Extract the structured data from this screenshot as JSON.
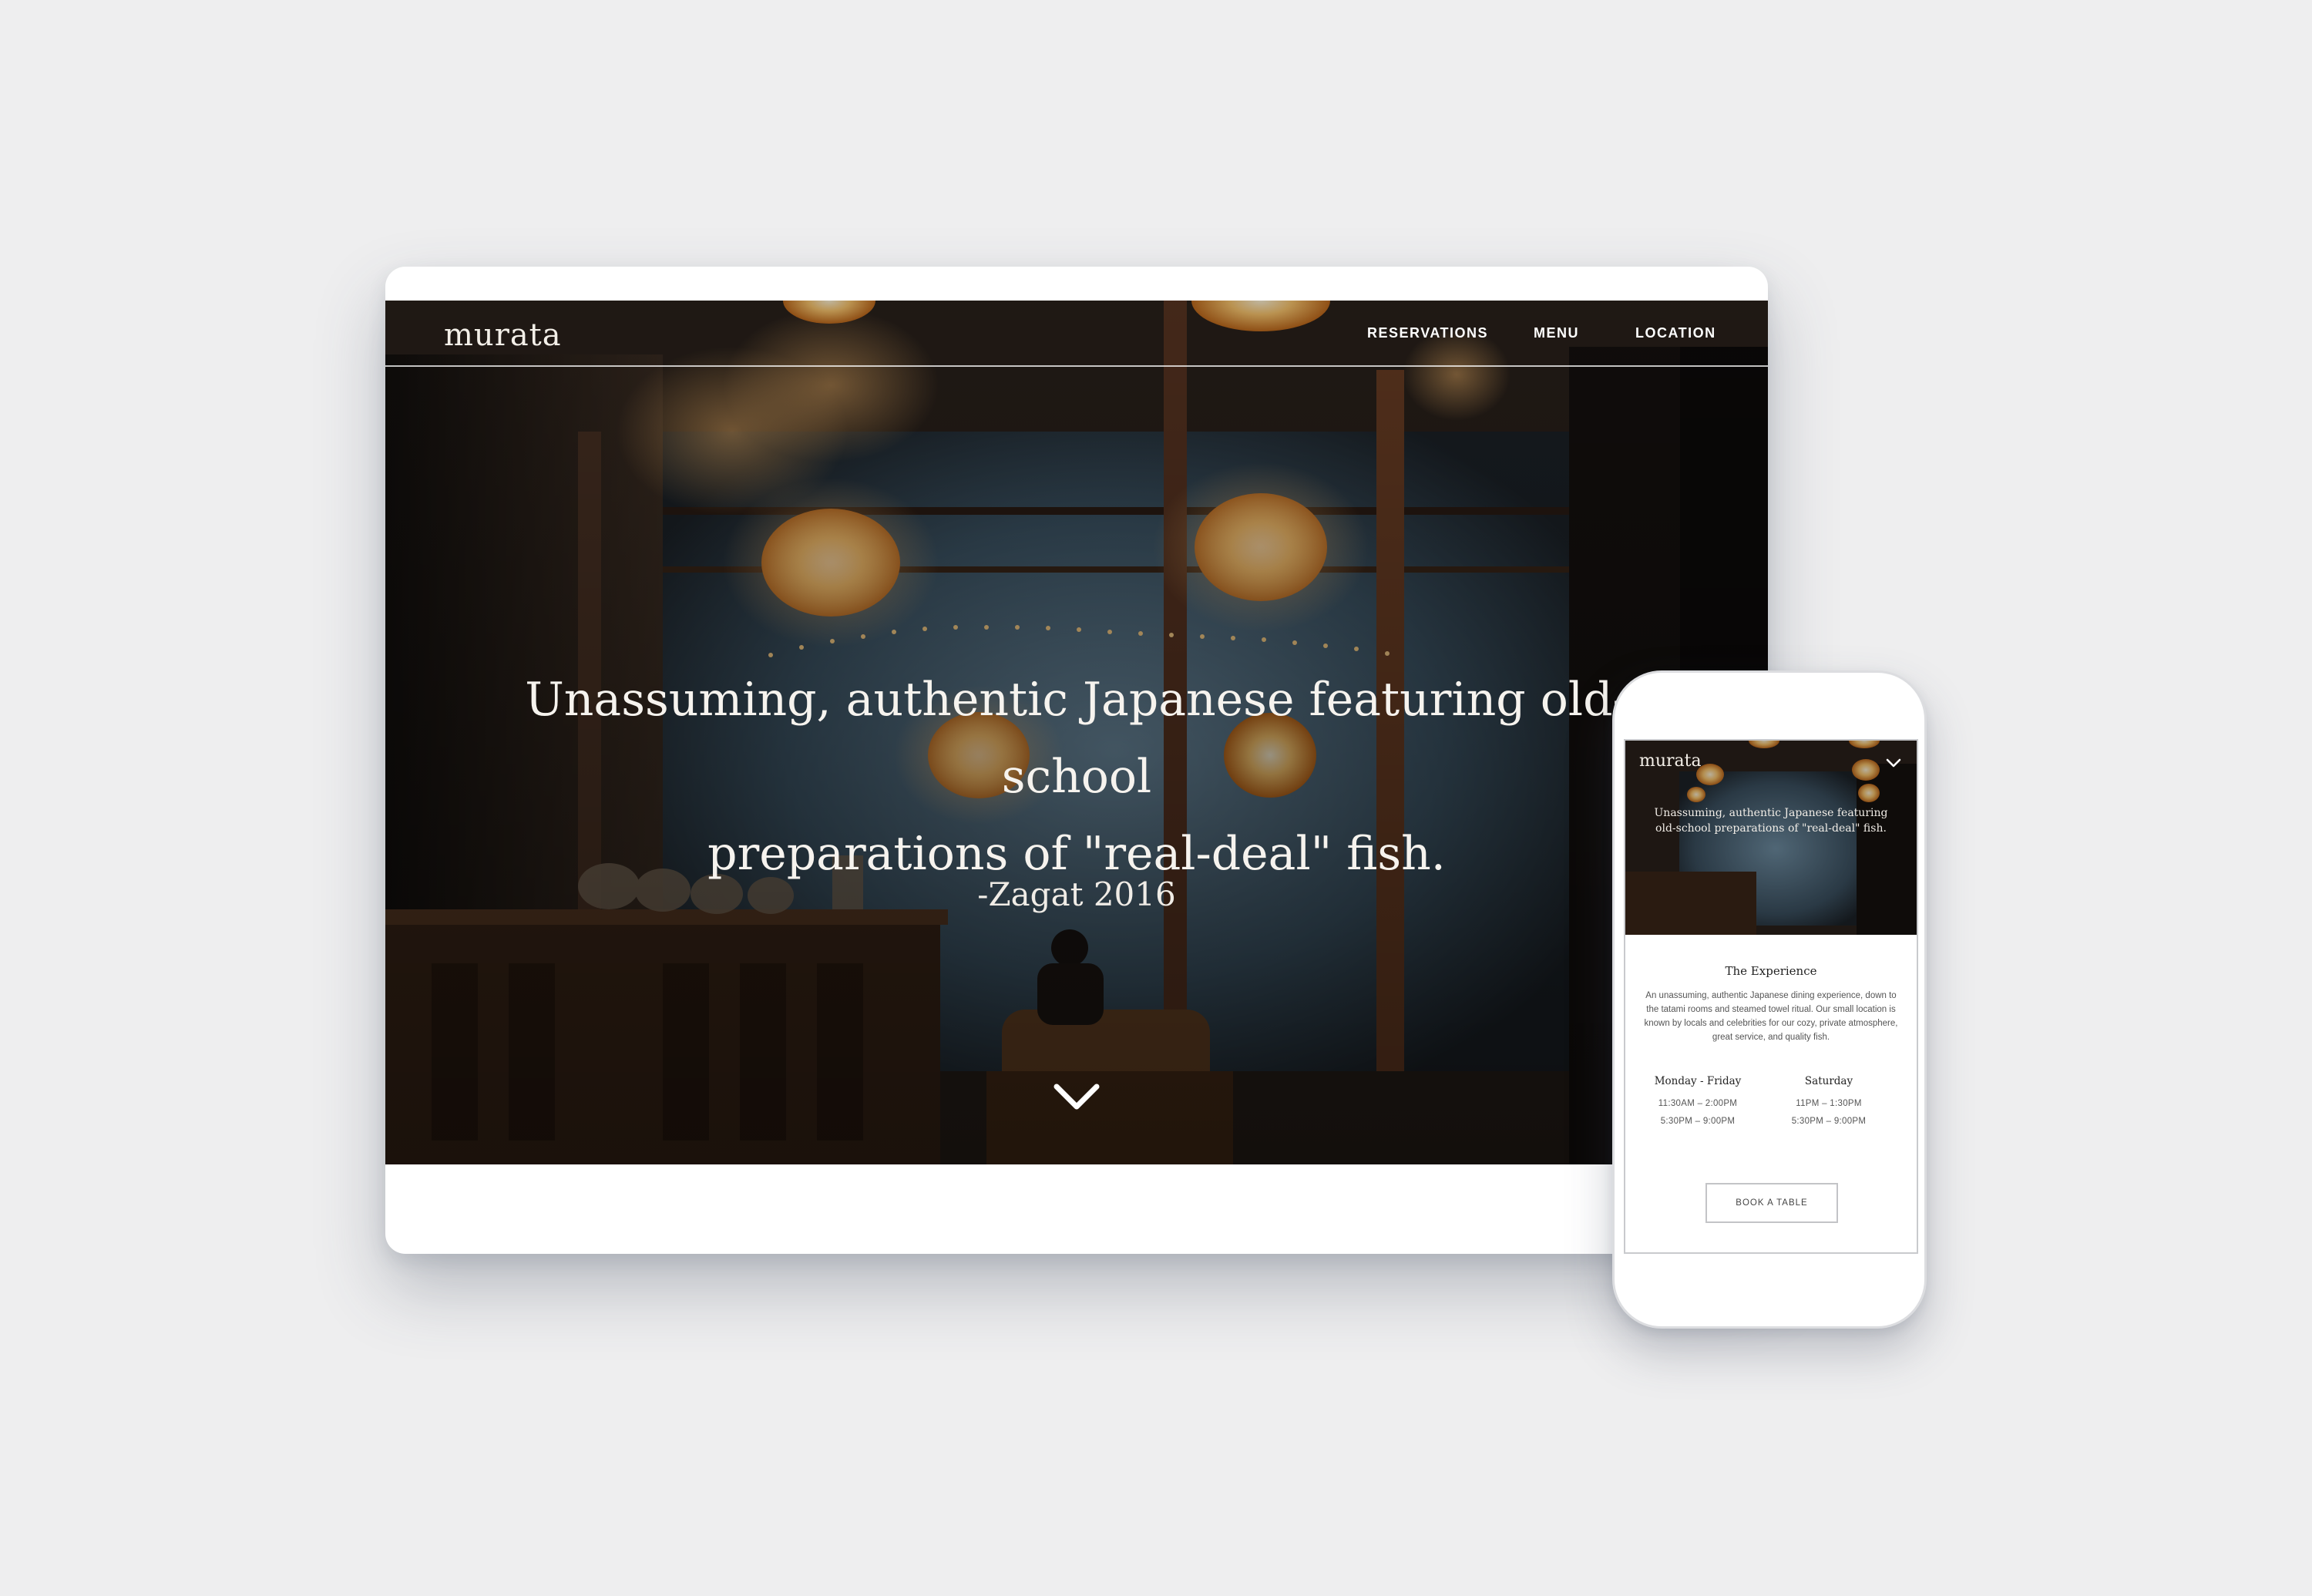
{
  "desktop": {
    "logo": "murata",
    "nav": {
      "reservations": "RESERVATIONS",
      "menu": "MENU",
      "location": "LOCATION"
    },
    "hero": {
      "line1": "Unassuming, authentic Japanese featuring old-school",
      "line2": "preparations of \"real-deal\" fish.",
      "cite": "-Zagat 2016",
      "scroll_icon": "chevron-down-icon"
    }
  },
  "mobile": {
    "logo": "murata",
    "menu_icon": "chevron-down-icon",
    "hero": {
      "line1": "Unassuming, authentic Japanese featuring",
      "line2": "old-school preparations of \"real-deal\" fish."
    },
    "experience": {
      "title": "The Experience",
      "description": "An unassuming, authentic Japanese dining experience, down to the tatami rooms and steamed towel ritual. Our small location is known by locals and celebrities for our cozy, private atmosphere, great service, and quality fish."
    },
    "hours": [
      {
        "days": "Monday - Friday",
        "lunch": "11:30AM – 2:00PM",
        "dinner": "5:30PM – 9:00PM"
      },
      {
        "days": "Saturday",
        "lunch": "11PM – 1:30PM",
        "dinner": "5:30PM – 9:00PM"
      }
    ],
    "cta": "BOOK A TABLE"
  },
  "colors": {
    "background": "#eeeeef",
    "hero_dark": "#1d1815",
    "lamp_glow": "#f7b45a",
    "window_blue": "#5f7f94"
  }
}
